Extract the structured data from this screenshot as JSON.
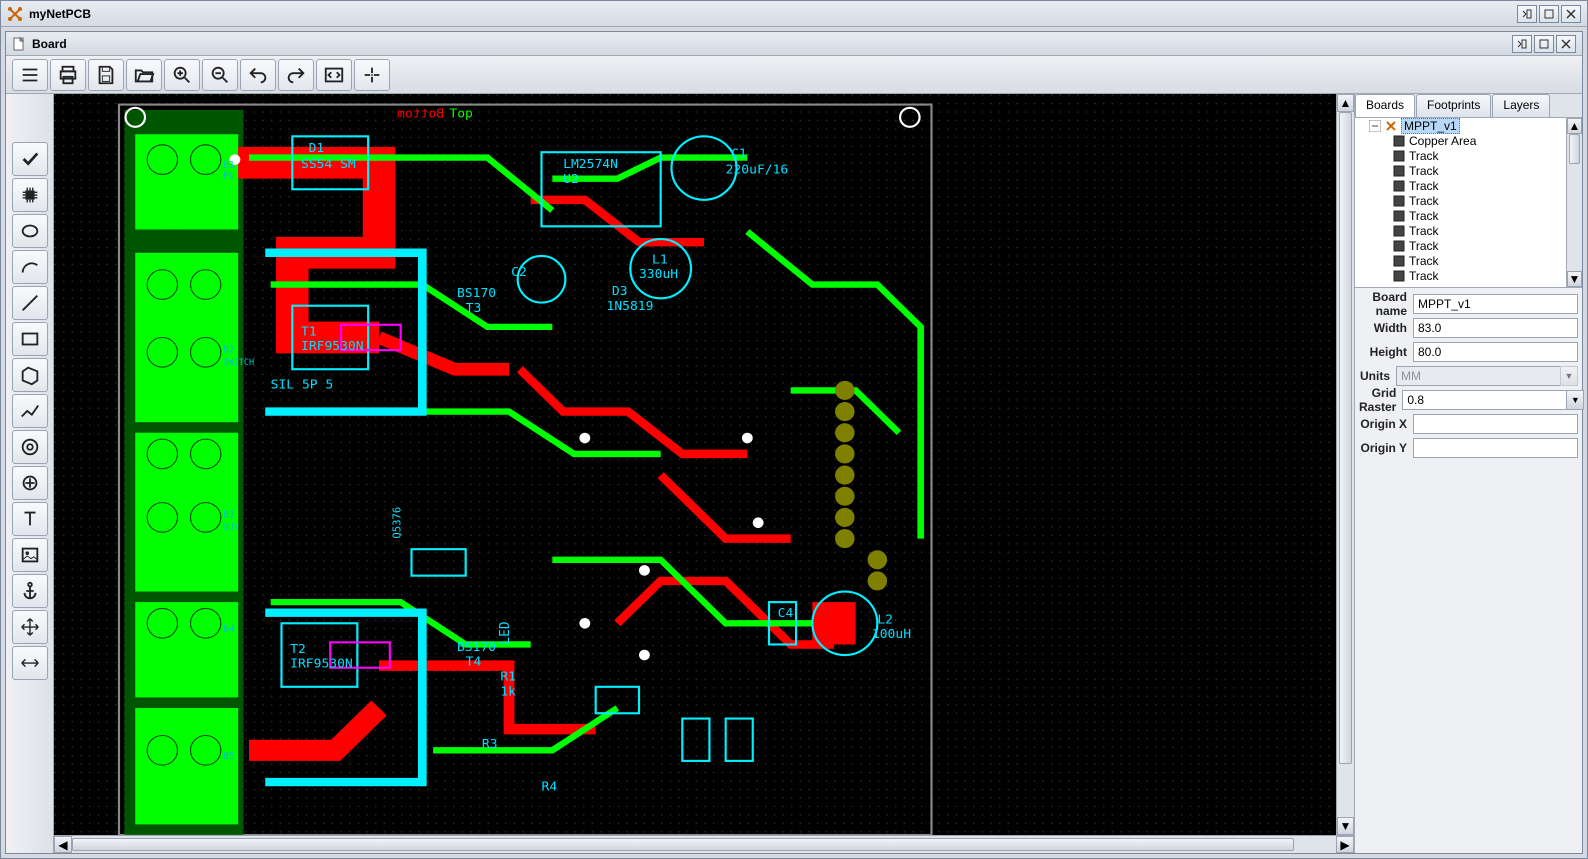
{
  "outer_window": {
    "title": "myNetPCB"
  },
  "inner_window": {
    "title": "Board"
  },
  "canvas_labels": {
    "top": "Top",
    "bottom": "Bottom",
    "d1": "D1",
    "ss54": "SS54 SM",
    "u2a": "LM2574N",
    "u2b": "U2",
    "c1a": "C1",
    "c1b": "220uF/16",
    "l1a": "L1",
    "l1b": "330uH",
    "c2a": "C2",
    "d3a": "D3",
    "d3b": "1N5819",
    "bs170a": "BS170",
    "t3": "T3",
    "irf9a": "IRF9530N",
    "sil": "SIL 5P 5",
    "r1a": "R1",
    "r1b": "1k",
    "t1": "T1",
    "irf9b": "IRF9530N",
    "t2": "T2",
    "bs170b": "BS170",
    "t4": "T4",
    "r3a": "R3",
    "r4a": "R4",
    "c4": "C4",
    "l2a": "L2",
    "l2b": "100uH",
    "led": "LED",
    "b1": "B1",
    "b2": "B2",
    "b3": "B3",
    "b4": "B4",
    "b5": "B5",
    "pu": "PU",
    "switch": "SWITCH",
    "q5376": "Q5376",
    "out": "OUT"
  },
  "right_panel": {
    "tabs": {
      "boards": "Boards",
      "footprints": "Footprints",
      "layers": "Layers"
    },
    "tree": {
      "root": "MPPT_v1",
      "items": [
        "Copper Area",
        "Track",
        "Track",
        "Track",
        "Track",
        "Track",
        "Track",
        "Track",
        "Track",
        "Track"
      ]
    },
    "props": {
      "board_name_label": "Board name",
      "board_name": "MPPT_v1",
      "width_label": "Width",
      "width": "83.0",
      "height_label": "Height",
      "height": "80.0",
      "units_label": "Units",
      "units": "MM",
      "grid_raster_label": "Grid Raster",
      "grid_raster": "0.8",
      "origin_x_label": "Origin X",
      "origin_x": "",
      "origin_y_label": "Origin Y",
      "origin_y": ""
    }
  }
}
